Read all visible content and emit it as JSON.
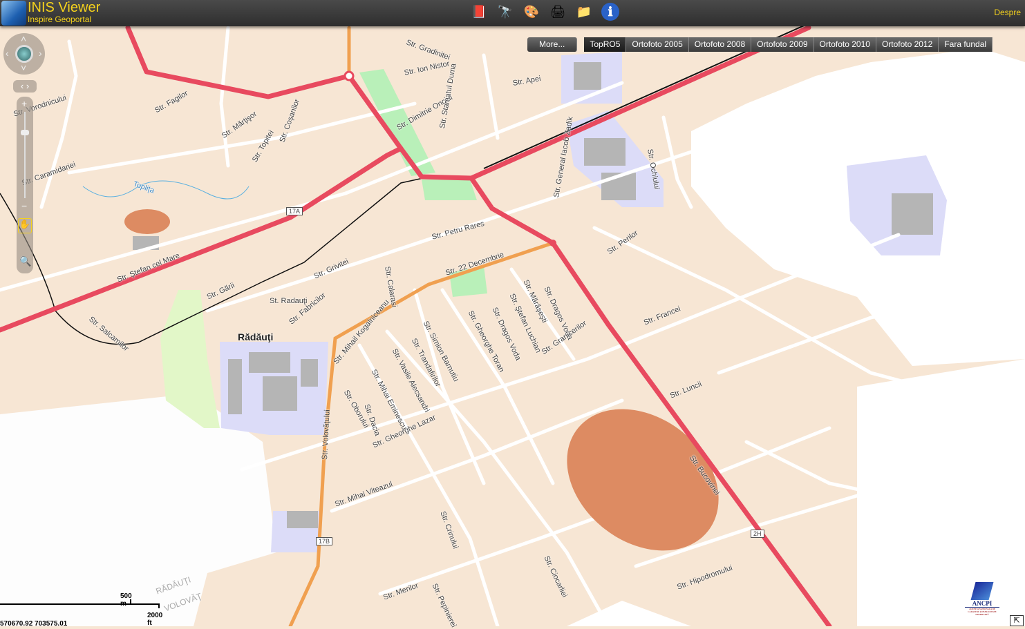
{
  "header": {
    "title": "INIS Viewer",
    "subtitle": "Inspire Geoportal",
    "about": "Despre"
  },
  "toolbar": [
    {
      "icon": "book-icon",
      "glyph": "📕"
    },
    {
      "icon": "binoculars-icon",
      "glyph": "🔭"
    },
    {
      "icon": "palette-icon",
      "glyph": "🎨"
    },
    {
      "icon": "printer-icon",
      "glyph": "🖨"
    },
    {
      "icon": "folder-icon",
      "glyph": "📁"
    },
    {
      "icon": "info-icon",
      "glyph": "ℹ"
    }
  ],
  "layers": {
    "more": "More...",
    "items": [
      "TopRO5",
      "Ortofoto 2005",
      "Ortofoto 2008",
      "Ortofoto 2009",
      "Ortofoto 2010",
      "Ortofoto 2012",
      "Fara fundal"
    ],
    "selected": "TopRO5"
  },
  "map": {
    "city": "Rădăuţi",
    "station": "St. Radauţi",
    "locality": [
      "RĂDĂUŢI",
      "VOLOVĂŢ"
    ],
    "streets": [
      "Str. Ştefan cel Mare",
      "Str. 22 Decembrie",
      "Str. Volovăţului",
      "Str. Bucovinei",
      "Str. Hipodromului",
      "Str. Luncii",
      "Str. Francei",
      "Str. Perilor",
      "Str. Ochiului",
      "Str. Grivitei",
      "Str. Gării",
      "Str. Fabricilor",
      "Str. Salcamilor",
      "Str. Caramidariei",
      "Str. Vorodnicului",
      "Str. Fagilor",
      "Str. Mărţişor",
      "Str. Topitei",
      "Str. Coşanilor",
      "Str. Ion Nistor",
      "Str. Apei",
      "Str. Gradinitei",
      "Str. Dimitrie Onciul",
      "Str. Stamatul Duma",
      "Str. Petru Rares",
      "Str. Calarasi",
      "Str. Dragos Voda",
      "Str. Granicerilor",
      "Str. Mihai Viteazul",
      "Str. Gheorghe Lazar",
      "Str. Oborului",
      "Str. Crinului",
      "Str. Ciocarliei",
      "Str. Merilor",
      "Str. Pepinierei",
      "Str. Mihai Eminescu",
      "Str. Vasile Alecsandri",
      "Str. Trandafirilor",
      "Str. Simion Barnutiu",
      "Str. Mihail Kogalniceanu",
      "Str. Gheorghe Toran",
      "Str. Dragos Voda",
      "Str. Ştefan Luchian",
      "Str. Mărăşeşti",
      "Str. General Iacob Zadik",
      "Str. Dacia"
    ],
    "road_numbers": [
      "17A",
      "17B",
      "2H"
    ],
    "river": "Topliţa"
  },
  "scale": {
    "metric": "500 m",
    "imperial": "2000 ft"
  },
  "coordinates": "570670.92 703575.01",
  "logo": {
    "text": "ANCPI",
    "caption": "AGENŢIA NAŢIONALĂ DE CADASTRU ŞI PUBLICITATE IMOBILIARĂ"
  },
  "colors": {
    "header": "#3a3a3a",
    "accent": "#f5d21c",
    "main_road": "#e84a5f",
    "secondary_road": "#f0a050",
    "background": "#f7e6d4"
  }
}
